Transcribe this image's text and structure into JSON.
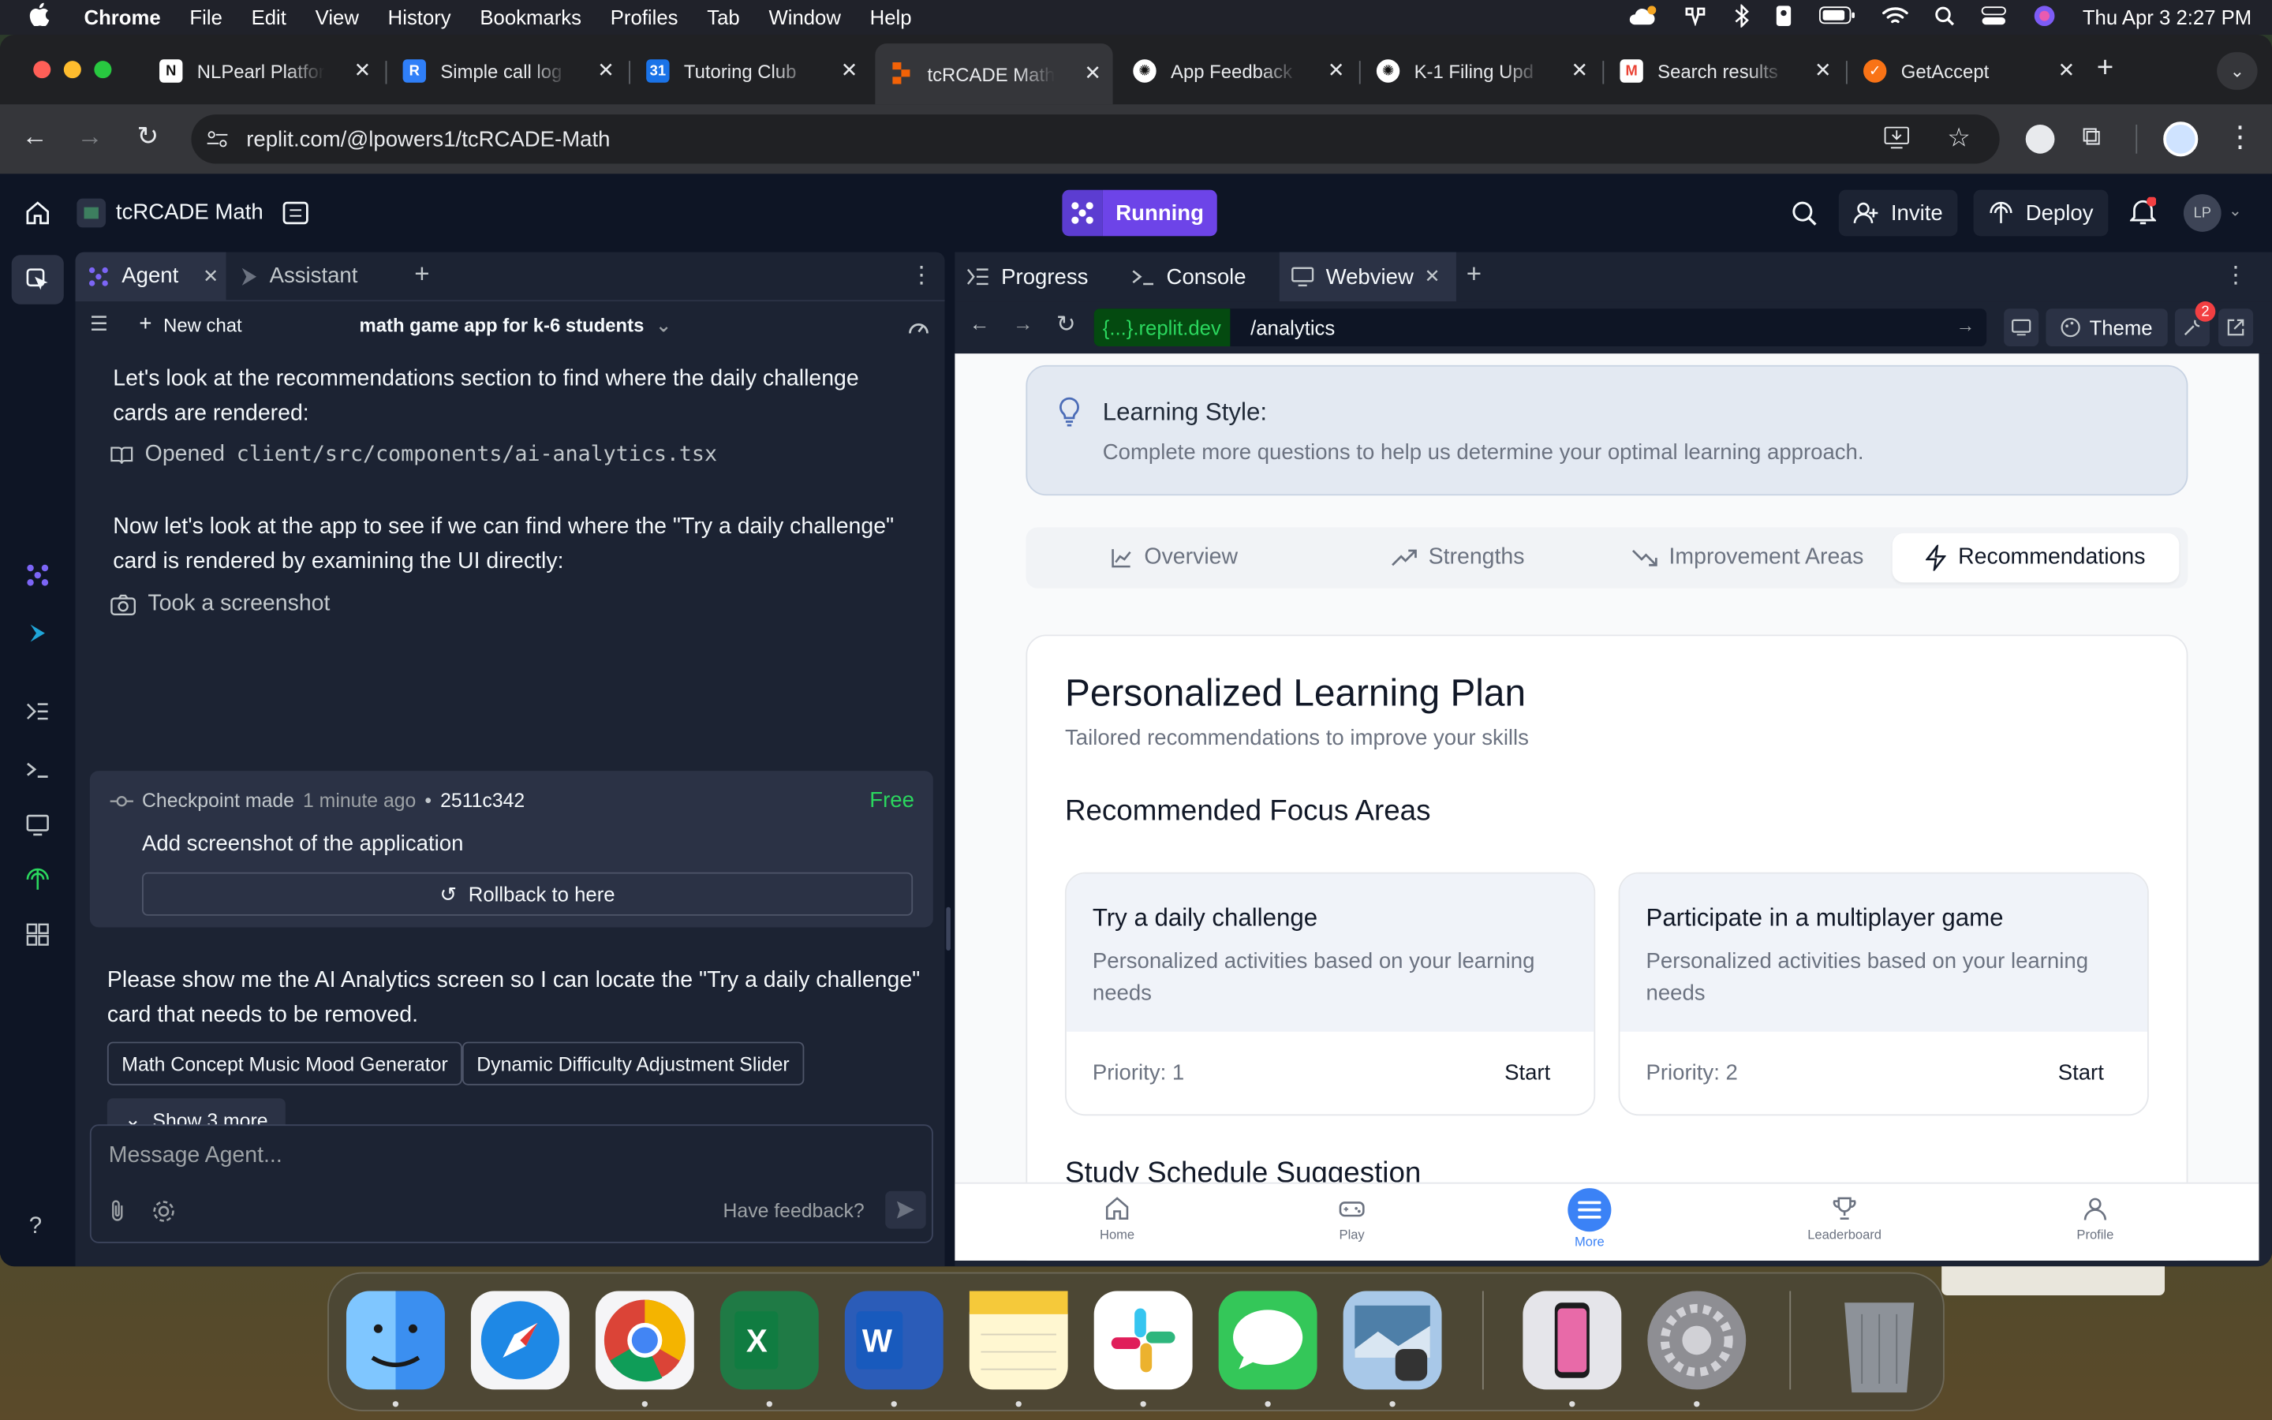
{
  "menubar": {
    "app": "Chrome",
    "items": [
      "File",
      "Edit",
      "View",
      "History",
      "Bookmarks",
      "Profiles",
      "Tab",
      "Window",
      "Help"
    ],
    "datetime": "Thu Apr 3  2:27 PM"
  },
  "browser": {
    "tabs": [
      {
        "title": "NLPearl Platfor",
        "favicon_color": "#ffffff"
      },
      {
        "title": "Simple call log",
        "favicon_color": "#2f7ff8"
      },
      {
        "title": "Tutoring Club",
        "favicon_color": "#1a73e8"
      },
      {
        "title": "tcRCADE Math",
        "favicon_color": "#f26207"
      },
      {
        "title": "App Feedback",
        "favicon_color": "#ffffff"
      },
      {
        "title": "K-1 Filing Upd",
        "favicon_color": "#ffffff"
      },
      {
        "title": "Search results",
        "favicon_color": "#ea4335"
      },
      {
        "title": "GetAccept",
        "favicon_color": "#f97316"
      }
    ],
    "url": "replit.com/@lpowers1/tcRCADE-Math"
  },
  "replit": {
    "project_title": "tcRCADE Math",
    "run_status": "Running",
    "invite_label": "Invite",
    "deploy_label": "Deploy",
    "avatar_initials": "LP",
    "notification_count": "2",
    "agent_panel": {
      "tabs": [
        "Agent",
        "Assistant"
      ],
      "new_chat": "New chat",
      "chat_title": "math game app for k-6 students",
      "messages": {
        "m1": "Let's look at the recommendations section to find where the daily challenge cards are rendered:",
        "opened_label": "Opened",
        "opened_path": "client/src/components/ai-analytics.tsx",
        "m2": "Now let's look at the app to see if we can find where the \"Try a daily challenge\" card is rendered by examining the UI directly:",
        "screenshot": "Took a screenshot"
      },
      "checkpoint": {
        "label": "Checkpoint made",
        "time": "1 minute ago",
        "bullet": "•",
        "hash": "2511c342",
        "badge": "Free",
        "description": "Add screenshot of the application",
        "rollback": "Rollback to here"
      },
      "user_message": "Please show me the AI Analytics screen so I can locate the \"Try a daily challenge\" card that needs to be removed.",
      "suggestions": [
        "Math Concept Music Mood Generator",
        "Dynamic Difficulty Adjustment Slider"
      ],
      "show_more": "Show 3 more",
      "input_placeholder": "Message Agent...",
      "feedback": "Have feedback?"
    },
    "right_panel": {
      "tabs": [
        "Progress",
        "Console",
        "Webview"
      ],
      "domain": "{...}.replit.dev",
      "path": "/analytics",
      "theme_label": "Theme",
      "theme_badge": "2"
    }
  },
  "webview": {
    "learning_style": {
      "title": "Learning Style:",
      "text": "Complete more questions to help us determine your optimal learning approach."
    },
    "tabs": [
      "Overview",
      "Strengths",
      "Improvement Areas",
      "Recommendations"
    ],
    "plan": {
      "title": "Personalized Learning Plan",
      "subtitle": "Tailored recommendations to improve your skills",
      "focus_heading": "Recommended Focus Areas",
      "cards": [
        {
          "title": "Try a daily challenge",
          "desc": "Personalized activities based on your learning needs",
          "priority": "Priority: 1",
          "action": "Start"
        },
        {
          "title": "Participate in a multiplayer game",
          "desc": "Personalized activities based on your learning needs",
          "priority": "Priority: 2",
          "action": "Start"
        }
      ],
      "schedule_heading": "Study Schedule Suggestion"
    },
    "bottom_nav": [
      "Home",
      "Play",
      "More",
      "Leaderboard",
      "Profile"
    ]
  },
  "colors": {
    "replit_bg": "#0e1525",
    "panel_bg": "#1c2333",
    "running_purple": "#6d44e8",
    "free_green": "#2bd75e",
    "more_blue": "#3b82f6"
  }
}
